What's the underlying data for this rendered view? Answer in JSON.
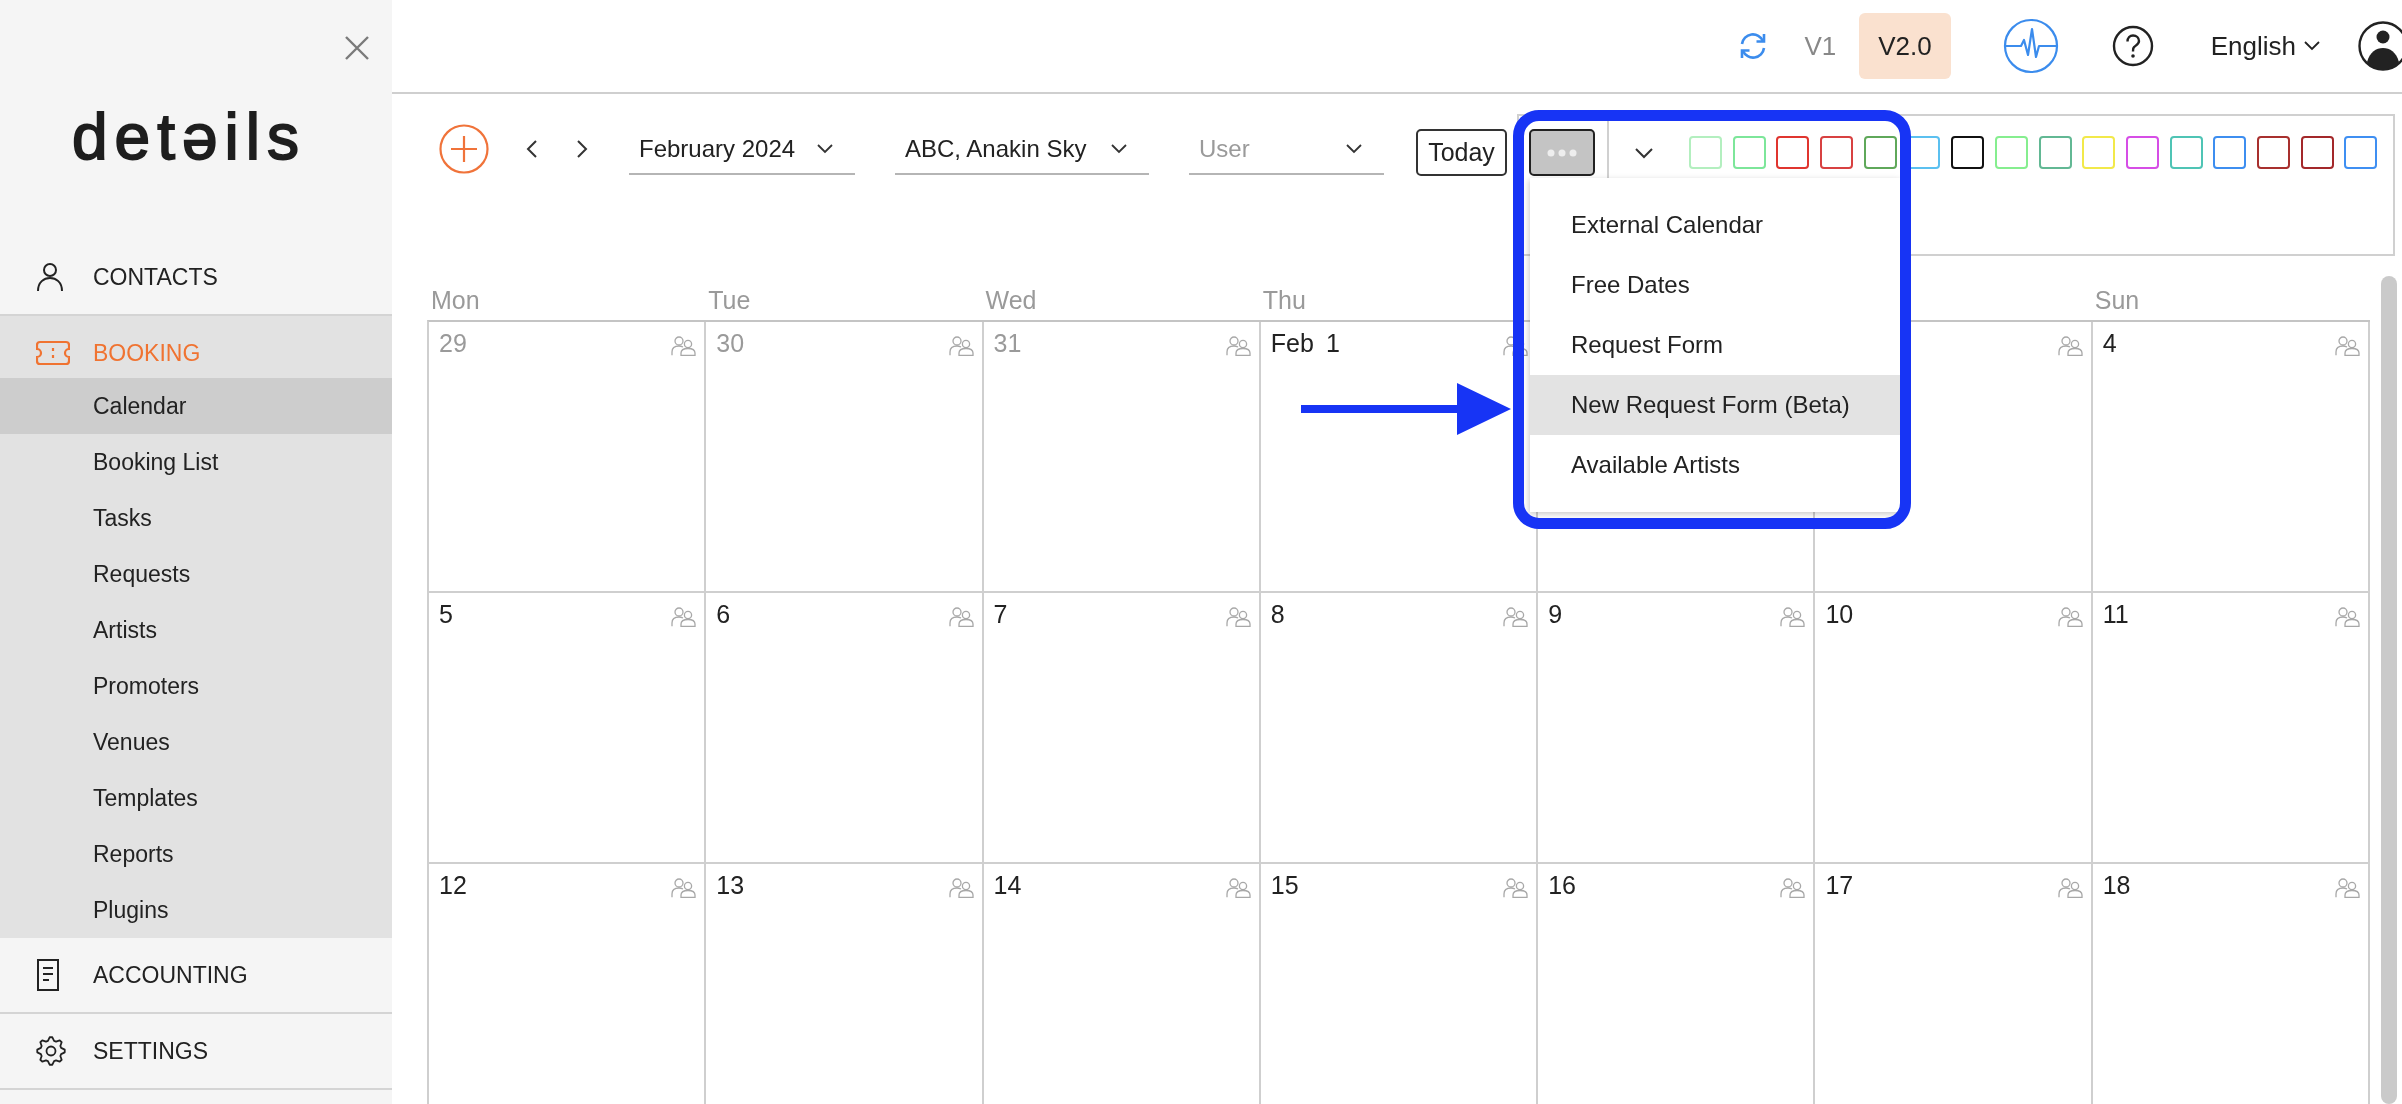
{
  "sidebar": {
    "logo": "detəils",
    "sections": [
      {
        "label": "CONTACTS",
        "selected": false,
        "expanded": false
      },
      {
        "label": "BOOKING",
        "selected": true,
        "expanded": true,
        "items": [
          {
            "label": "Calendar",
            "selected": true
          },
          {
            "label": "Booking List",
            "selected": false
          },
          {
            "label": "Tasks",
            "selected": false
          },
          {
            "label": "Requests",
            "selected": false
          },
          {
            "label": "Artists",
            "selected": false
          },
          {
            "label": "Promoters",
            "selected": false
          },
          {
            "label": "Venues",
            "selected": false
          },
          {
            "label": "Templates",
            "selected": false
          },
          {
            "label": "Reports",
            "selected": false
          },
          {
            "label": "Plugins",
            "selected": false
          }
        ]
      },
      {
        "label": "ACCOUNTING",
        "selected": false,
        "expanded": false
      },
      {
        "label": "SETTINGS",
        "selected": false,
        "expanded": false
      }
    ]
  },
  "top_bar": {
    "versions": [
      {
        "label": "V1",
        "selected": false
      },
      {
        "label": "V2.0",
        "selected": true
      }
    ],
    "language": "English"
  },
  "toolbar": {
    "month": "February 2024",
    "artist": "ABC, Anakin Sky",
    "user": {
      "placeholder": "User"
    },
    "today": "Today",
    "more_open": true,
    "swatches": [
      {
        "color": "#b3efbf"
      },
      {
        "color": "#7de69a"
      },
      {
        "color": "#e0352f"
      },
      {
        "color": "#d84141"
      },
      {
        "color": "#5fa85a"
      },
      {
        "color": "#5bc0f0"
      },
      {
        "color": "#111111"
      },
      {
        "color": "#86ee8f"
      },
      {
        "color": "#62b894"
      },
      {
        "color": "#f2e94a"
      },
      {
        "color": "#d64ee6"
      },
      {
        "color": "#4fc4b5"
      },
      {
        "color": "#3d8ef0"
      },
      {
        "color": "#a8302e"
      },
      {
        "color": "#a3282a"
      },
      {
        "color": "#3f8ff2"
      }
    ]
  },
  "more_menu": {
    "items": [
      {
        "label": "External Calendar",
        "highlighted": false
      },
      {
        "label": "Free Dates",
        "highlighted": false
      },
      {
        "label": "Request Form",
        "highlighted": false
      },
      {
        "label": "New Request Form (Beta)",
        "highlighted": true
      },
      {
        "label": "Available Artists",
        "highlighted": false
      }
    ]
  },
  "calendar": {
    "weekdays": [
      {
        "kind": "label",
        "label": "Mon"
      },
      {
        "kind": "label",
        "label": "Tue"
      },
      {
        "kind": "label",
        "label": "Wed"
      },
      {
        "kind": "label",
        "label": "Thu"
      },
      {
        "kind": "covered"
      },
      {
        "kind": "covered"
      },
      {
        "kind": "label",
        "label": "Sun"
      }
    ],
    "weeks": [
      [
        {
          "kind": "day",
          "day": "29",
          "outside_month": true
        },
        {
          "kind": "day",
          "day": "30",
          "outside_month": true
        },
        {
          "kind": "day",
          "day": "31",
          "outside_month": true
        },
        {
          "kind": "day",
          "month": "Feb",
          "day": "1",
          "outside_month": false
        },
        {
          "kind": "covered"
        },
        {
          "kind": "icon_only"
        },
        {
          "kind": "day",
          "day": "4",
          "outside_month": false
        }
      ],
      [
        {
          "kind": "day",
          "day": "5",
          "outside_month": false
        },
        {
          "kind": "day",
          "day": "6",
          "outside_month": false
        },
        {
          "kind": "day",
          "day": "7",
          "outside_month": false
        },
        {
          "kind": "day",
          "day": "8",
          "outside_month": false
        },
        {
          "kind": "day",
          "day": "9",
          "outside_month": false
        },
        {
          "kind": "day",
          "day": "10",
          "outside_month": false
        },
        {
          "kind": "day",
          "day": "11",
          "outside_month": false
        }
      ],
      [
        {
          "kind": "day",
          "day": "12",
          "outside_month": false
        },
        {
          "kind": "day",
          "day": "13",
          "outside_month": false
        },
        {
          "kind": "day",
          "day": "14",
          "outside_month": false
        },
        {
          "kind": "day",
          "day": "15",
          "outside_month": false
        },
        {
          "kind": "day",
          "day": "16",
          "outside_month": false
        },
        {
          "kind": "day",
          "day": "17",
          "outside_month": false
        },
        {
          "kind": "day",
          "day": "18",
          "outside_month": false
        }
      ]
    ]
  }
}
